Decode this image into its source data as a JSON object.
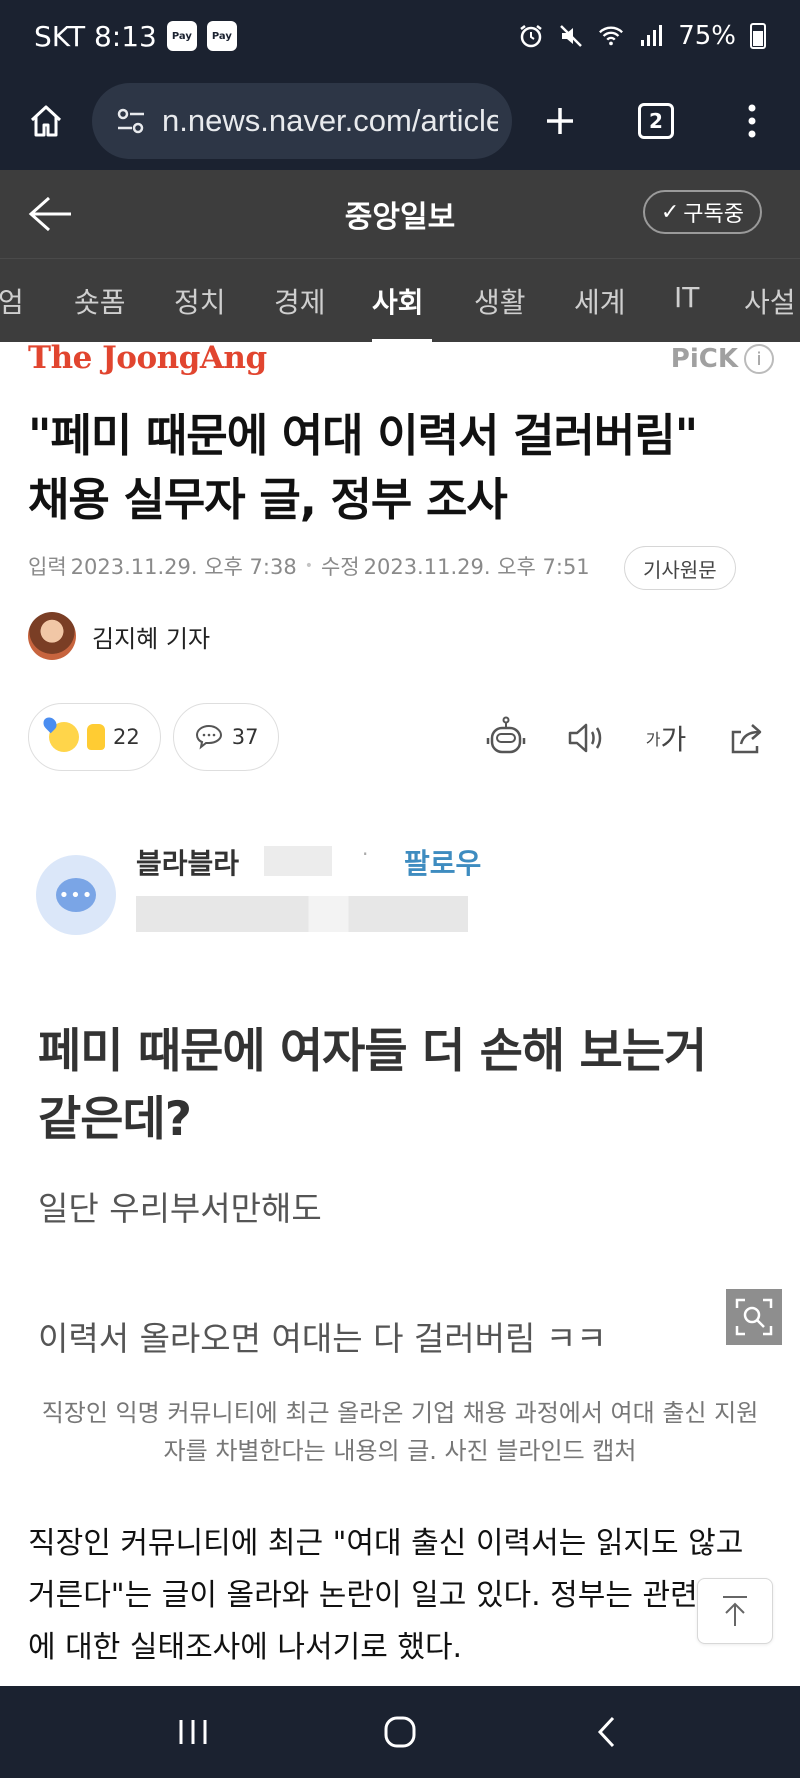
{
  "status_bar": {
    "carrier_time": "SKT 8:13",
    "pay_badges": [
      "Pay",
      "Pay"
    ],
    "battery": "75%",
    "icons": [
      "alarm-icon",
      "mute-icon",
      "wifi-icon",
      "signal-icon",
      "battery-icon"
    ]
  },
  "browser": {
    "url": "n.news.naver.com/article",
    "tab_count": "2",
    "icons": [
      "home-icon",
      "site-settings-icon",
      "new-tab-icon",
      "tab-switcher-icon",
      "menu-icon"
    ]
  },
  "app_header": {
    "title": "중앙일보",
    "subscribe_label": "구독중"
  },
  "category_tabs": [
    {
      "label": "엄",
      "active": false
    },
    {
      "label": "숏폼",
      "active": false
    },
    {
      "label": "정치",
      "active": false
    },
    {
      "label": "경제",
      "active": false
    },
    {
      "label": "사회",
      "active": true
    },
    {
      "label": "생활",
      "active": false
    },
    {
      "label": "세계",
      "active": false
    },
    {
      "label": "IT",
      "active": false
    },
    {
      "label": "사설",
      "active": false
    }
  ],
  "article": {
    "brand": "The JoongAng",
    "pick_label": "PiCK",
    "pick_info": "i",
    "headline_line1": "\"페미 때문에 여대 이력서 걸러버림\"",
    "headline_line2": "채용 실무자 글, 정부 조사",
    "input_label": "입력",
    "input_date": "2023.11.29. 오후 7:38",
    "edit_label": "수정",
    "edit_date": "2023.11.29. 오후 7:51",
    "original_button": "기사원문",
    "reporter": "김지혜 기자",
    "reactions_count": "22",
    "comments_count": "37",
    "font_size_small": "가",
    "font_size_big": "가"
  },
  "embed": {
    "user_name": "블라블라",
    "dot": "·",
    "follow_label": "팔로우",
    "post_title": "페미 때문에 여자들 더 손해 보는거 같은데?",
    "post_line1": "일단 우리부서만해도",
    "post_line2": "이력서 올라오면 여대는 다 걸러버림 ㅋㅋ"
  },
  "caption": "직장인 익명 커뮤니티에 최근 올라온 기업 채용 과정에서 여대 출신 지원자를 차별한다는 내용의 글. 사진 블라인드 캡처",
  "body_text": "직장인 커뮤니티에 최근 \"여대 출신 이력서는 읽지도 않고 거른다\"는 글이 올라와 논란이 일고 있다. 정부는 관련 기업에 대한 실태조사에 나서기로 했다.",
  "colors": {
    "status_bg": "#1b2230",
    "header_bg": "#3d3d3d",
    "brand_red": "#e1452f",
    "follow_blue": "#3e8cc0"
  }
}
